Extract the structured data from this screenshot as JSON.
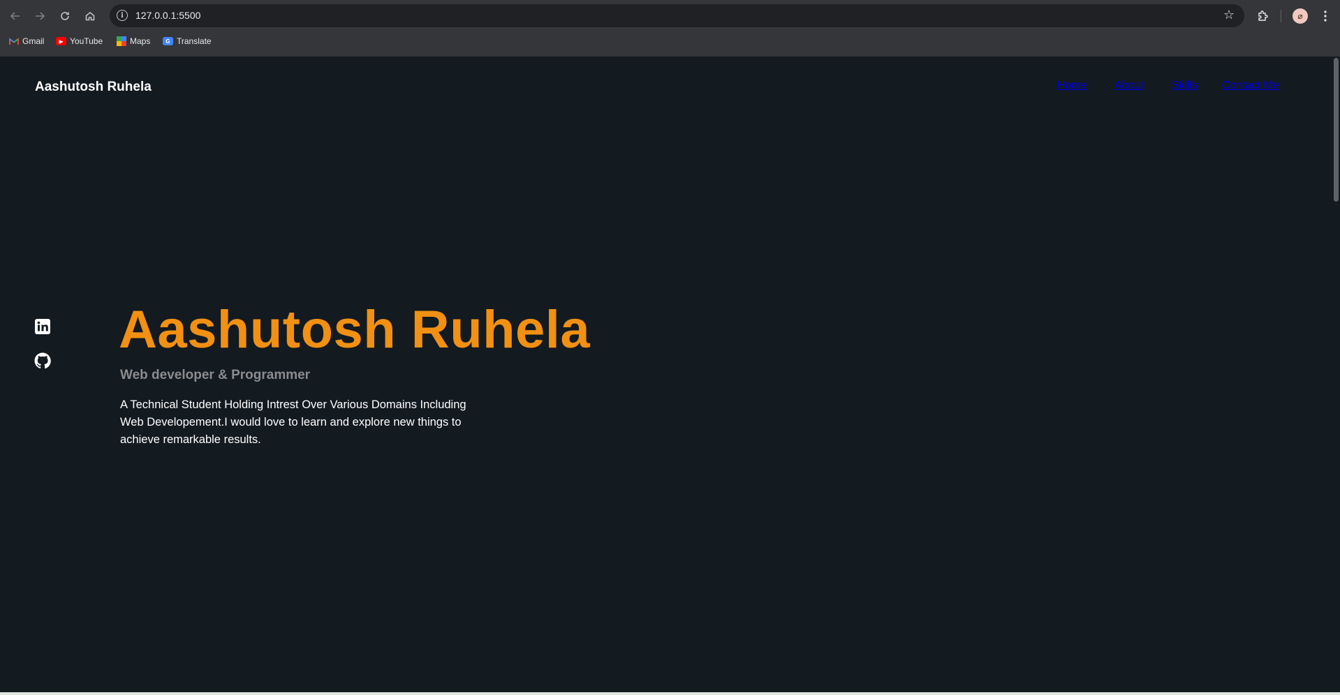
{
  "browser": {
    "url": "127.0.0.1:5500",
    "bookmarks": [
      {
        "label": "Gmail",
        "icon": "gmail-icon"
      },
      {
        "label": "YouTube",
        "icon": "youtube-icon"
      },
      {
        "label": "Maps",
        "icon": "maps-icon"
      },
      {
        "label": "Translate",
        "icon": "translate-icon"
      }
    ]
  },
  "site": {
    "brand": "Aashutosh Ruhela",
    "nav": [
      "Home",
      "About",
      "Skills",
      "Contact Me"
    ]
  },
  "hero": {
    "name": "Aashutosh Ruhela",
    "role": "Web developer & Programmer",
    "description": "A Technical Student Holding Intrest Over Various Domains Including Web Developement.I would love to learn and explore new things to achieve remarkable results."
  },
  "socials": [
    {
      "name": "linkedin-icon"
    },
    {
      "name": "github-icon"
    }
  ],
  "colors": {
    "background": "#131a20",
    "accent": "#f19012",
    "muted": "#8a8c8e",
    "text": "#ffffff"
  }
}
